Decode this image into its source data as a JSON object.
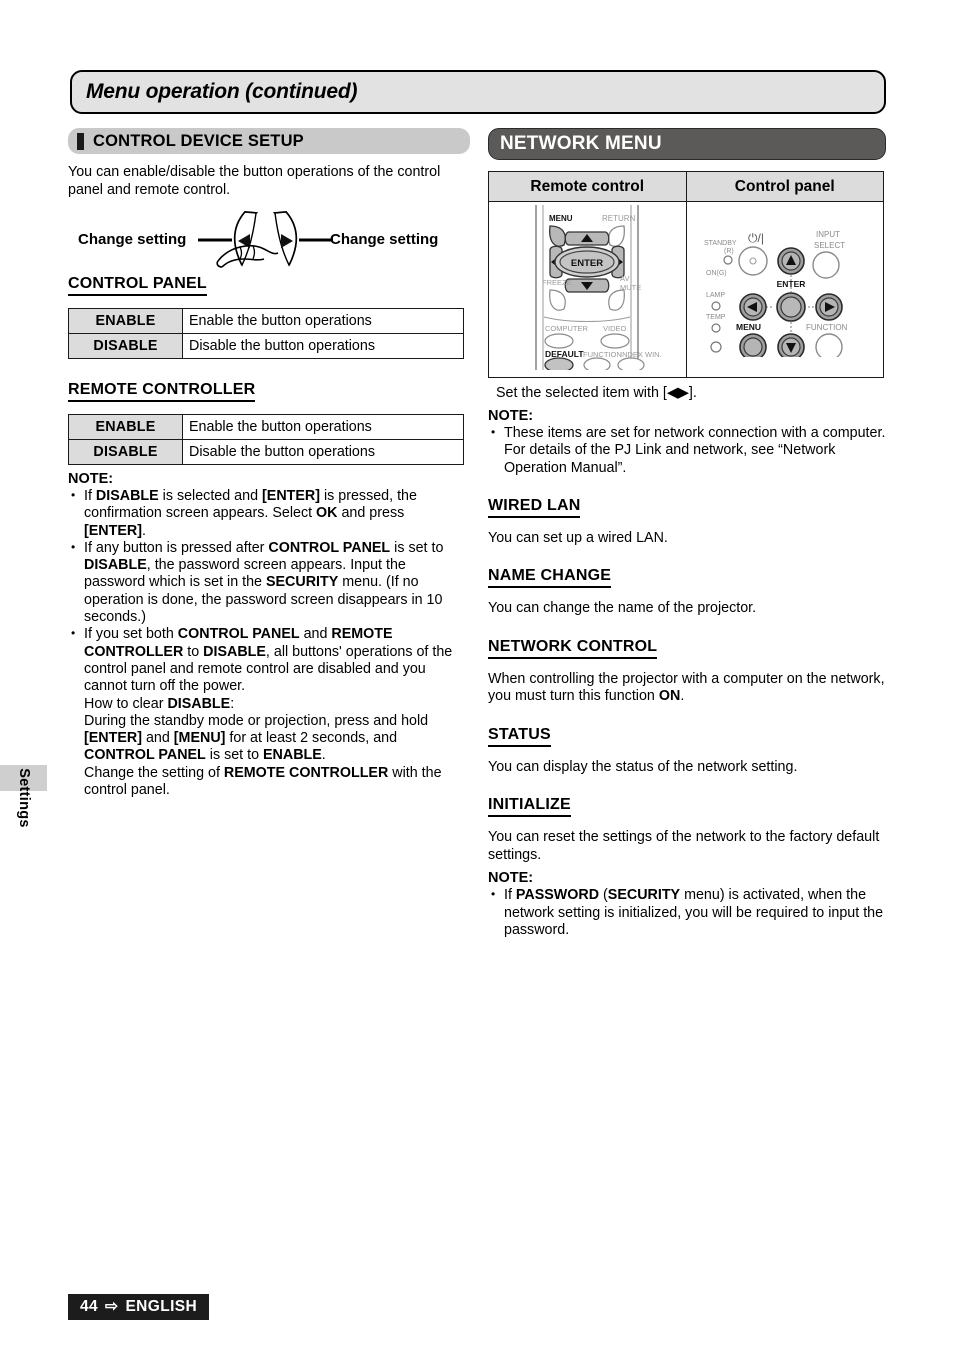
{
  "page": {
    "title": "Menu operation (continued)",
    "side_tab_label": "Settings",
    "footer_page_number": "44",
    "footer_arrow": "⇨",
    "footer_language": "ENGLISH"
  },
  "left_column": {
    "section_header": "CONTROL DEVICE SETUP",
    "intro": "You can enable/disable the button operations of the control panel and remote control.",
    "change_setting_left_label": "Change setting",
    "change_setting_right_label": "Change setting",
    "control_panel": {
      "heading": "CONTROL PANEL",
      "rows": [
        {
          "key": "ENABLE",
          "value": "Enable the button operations"
        },
        {
          "key": "DISABLE",
          "value": "Disable the button operations"
        }
      ]
    },
    "remote_controller": {
      "heading": "REMOTE CONTROLLER",
      "rows": [
        {
          "key": "ENABLE",
          "value": "Enable the button operations"
        },
        {
          "key": "DISABLE",
          "value": "Disable the button operations"
        }
      ]
    },
    "note": {
      "title": "NOTE:",
      "items": [
        "If <b>DISABLE</b> is selected and <b>[ENTER]</b> is pressed, the confirmation screen appears. Select <b>OK</b> and press <b>[ENTER]</b>.",
        "If any button is pressed after <b>CONTROL PANEL</b> is set to <b>DISABLE</b>, the password screen appears. Input the password which is set in the <b>SECURITY</b> menu. (If no operation is done, the password screen disappears in 10 seconds.)",
        "If you set both <b>CONTROL PANEL</b> and <b>REMOTE CONTROLLER</b> to <b>DISABLE</b>, all buttons' operations of the control panel and remote control are disabled and you cannot turn off the power."
      ],
      "sub_items": [
        "How to clear <b>DISABLE</b>:",
        "During the standby mode or projection, press and hold <b>[ENTER]</b> and <b>[MENU]</b> for at least 2 seconds, and <b>CONTROL PANEL</b> is set to <b>ENABLE</b>.",
        "Change the setting of <b>REMOTE CONTROLLER</b> with the control panel."
      ]
    }
  },
  "right_column": {
    "section_header": "NETWORK MENU",
    "device_table": {
      "headers": [
        "Remote control",
        "Control panel"
      ],
      "remote_control_buttons": {
        "menu": "MENU",
        "return": "RETURN",
        "enter": "ENTER",
        "freeze": "FREEZE",
        "av_mute_line1": "AV",
        "av_mute_line2": "MUTE",
        "computer": "COMPUTER",
        "video": "VIDEO",
        "default": "DEFAULT",
        "function": "FUNCTION",
        "index_win": "INDEX WIN."
      },
      "control_panel_labels": {
        "standby": "STANDBY",
        "standby_color": "(R)",
        "on": "ON(G)",
        "power_symbol": "⏻/|",
        "input_select_line1": "INPUT",
        "input_select_line2": "SELECT",
        "lamp": "LAMP",
        "temp": "TEMP",
        "enter": "ENTER",
        "menu": "MENU",
        "function": "FUNCTION"
      }
    },
    "set_selected_item": "Set the selected item with [◀▶].",
    "note_top": {
      "title": "NOTE:",
      "items": [
        "These items are set for network connection with a computer. For details of the PJ Link and network, see “Network Operation Manual”."
      ]
    },
    "sections": [
      {
        "heading": "WIRED LAN",
        "body": "You can set up a wired LAN."
      },
      {
        "heading": "NAME CHANGE",
        "body": "You can change the name of the projector."
      },
      {
        "heading": "NETWORK CONTROL",
        "body": "When controlling the projector with a computer on the network, you must turn this function <b>ON</b>."
      },
      {
        "heading": "STATUS",
        "body": "You can display the status of the network setting."
      },
      {
        "heading": "INITIALIZE",
        "body": "You can reset the settings of the network to the factory default settings."
      }
    ],
    "note_bottom": {
      "title": "NOTE:",
      "items": [
        "If <b>PASSWORD</b> (<b>SECURITY</b> menu) is activated, when the network setting is initialized, you will be required to input the password."
      ]
    }
  },
  "colors": {
    "title_bar_bg": "#e2e2e2",
    "light_header_bg": "#c9c9c9",
    "dark_header_bg": "#5c5a58",
    "table_key_bg": "#dcdcdc",
    "footer_bg": "#1c1c1c"
  }
}
